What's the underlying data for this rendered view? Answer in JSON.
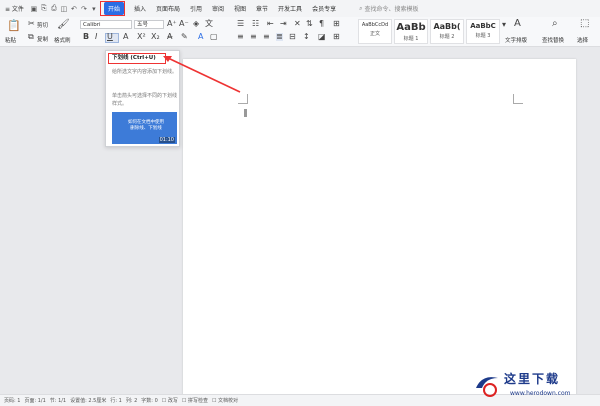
{
  "menubar": {
    "file": "≡ 文件",
    "tabs": [
      "开始",
      "插入",
      "页面布局",
      "引用",
      "审阅",
      "视图",
      "章节",
      "开发工具",
      "会员专享"
    ],
    "search": "查找命令、搜索模板"
  },
  "ribbon": {
    "paste": "粘贴",
    "cut": "剪切",
    "copy": "复制",
    "format_painter": "格式刷",
    "font_name": "Calibri",
    "font_size": "五号",
    "styles": [
      {
        "sample": "AaBbCcDd",
        "name": "正文"
      },
      {
        "sample": "AaBb",
        "name": "标题 1"
      },
      {
        "sample": "AaBb(",
        "name": "标题 2"
      },
      {
        "sample": "AaBbC",
        "name": "标题 3"
      }
    ],
    "text_layout": "文字排版",
    "find_replace": "查找替换",
    "select": "选择"
  },
  "tooltip": {
    "title": "下划线 (Ctrl+U)",
    "desc1": "给所选文字内容添加下划线。",
    "desc2": "单击箭头可选择不同的下划线样式。",
    "video_text": "如何在文档中使用删除线、下划线",
    "video_duration": "01:10"
  },
  "statusbar": {
    "items": [
      "页码: 1",
      "页面: 1/1",
      "节: 1/1",
      "设置值: 2.5厘米",
      "行: 1",
      "列: 2",
      "字数: 0",
      "改写",
      "拼写检查",
      "文档校对"
    ]
  },
  "watermark": {
    "text": "这里下载",
    "url": "www.herodown.com"
  },
  "colors": {
    "accent": "#2b6de5",
    "highlight_red": "#e33"
  }
}
